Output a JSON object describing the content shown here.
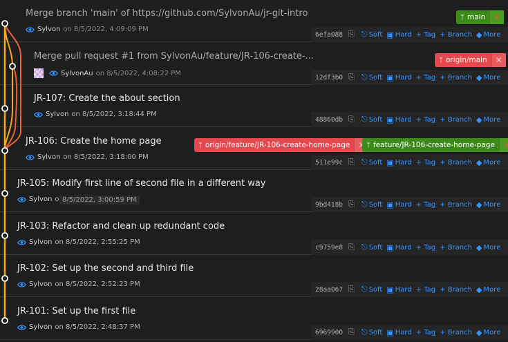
{
  "commits": [
    {
      "message": "Merge branch 'main' of https://github.com/SylvonAu/jr-git-intro",
      "author": "Sylvon",
      "date": "on 8/5/2022, 4:09:09 PM",
      "sha": "6efa088",
      "avatar": false
    },
    {
      "message": "Merge pull request #1 from SylvonAu/feature/JR-106-create-...",
      "author": "SylvonAu",
      "date": "on 8/5/2022, 4:08:22 PM",
      "sha": "12df3b0",
      "avatar": true
    },
    {
      "message": "JR-107: Create the about section",
      "author": "Sylvon",
      "date": "on 8/5/2022, 3:18:44 PM",
      "sha": "48860db",
      "avatar": false
    },
    {
      "message": "JR-106: Create the home page",
      "author": "Sylvon",
      "date": "on 8/5/2022, 3:18:00 PM",
      "sha": "511e99c",
      "avatar": false
    },
    {
      "message": "JR-105: Modify first line of second file in a different way",
      "author": "Sylvon",
      "date": "on 8/5/2022, 3:00:59 PM",
      "sha": "9bd418b",
      "avatar": false
    },
    {
      "message": "JR-103: Refactor and clean up redundant code",
      "author": "Sylvon",
      "date": "on 8/5/2022, 2:55:25 PM",
      "sha": "c9759e8",
      "avatar": false
    },
    {
      "message": "JR-102: Set up the second and third file",
      "author": "Sylvon",
      "date": "on 8/5/2022, 2:52:23 PM",
      "sha": "28aa067",
      "avatar": false
    },
    {
      "message": "JR-101: Set up the first file",
      "author": "Sylvon",
      "date": "on 8/5/2022, 2:48:37 PM",
      "sha": "6969900",
      "avatar": false
    }
  ],
  "actions": {
    "soft": "Soft",
    "hard": "Hard",
    "tag": "+ Tag",
    "branch": "+ Branch",
    "more": "More"
  },
  "branches": {
    "main": "main",
    "origin_main": "origin/main",
    "origin_feature": "origin/feature/JR-106-create-home-page",
    "feature": "feature/JR-106-create-home-page"
  },
  "tooltip": "8/5/2022, 3:00:59 PM",
  "colors": {
    "graph_main": "#f5a623",
    "graph_branch": "#e8623b",
    "action": "#3794ff",
    "local_branch": "#3c8a1a",
    "remote_branch": "#e5484d"
  }
}
